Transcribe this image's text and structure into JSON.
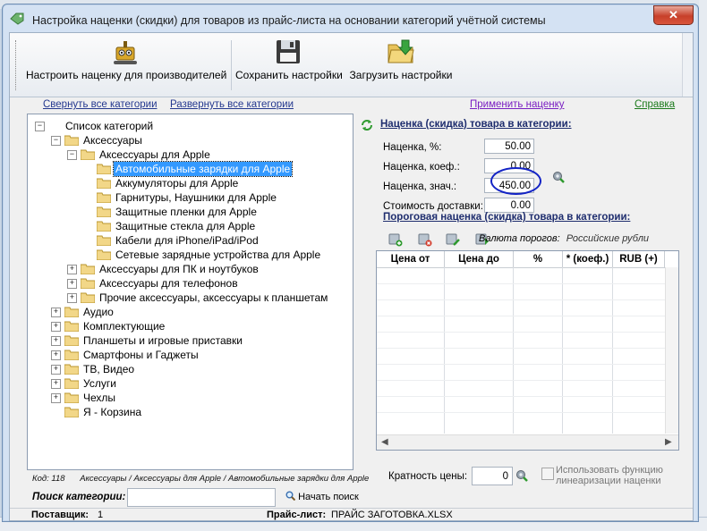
{
  "window": {
    "title": "Настройка наценки (скидки) для товаров из прайс-листа на основании категорий учётной системы",
    "close_label": "✕"
  },
  "toolbar": {
    "buttons": [
      {
        "label": "Настроить наценку для производителей",
        "icon": "robot-icon"
      },
      {
        "label": "Сохранить настройки",
        "icon": "floppy-disk-icon"
      },
      {
        "label": "Загрузить настройки",
        "icon": "folder-load-icon"
      }
    ]
  },
  "links": {
    "collapse_all": "Свернуть все категории",
    "expand_all": "Развернуть все категории",
    "apply": "Применить наценку",
    "help": "Справка"
  },
  "tree": {
    "root": "Список категорий",
    "items": [
      "Аксессуары",
      "Аксессуары для Apple",
      "Автомобильные зарядки для Apple",
      "Аккумуляторы для Apple",
      "Гарнитуры, Наушники для Apple",
      "Защитные пленки для Apple",
      "Защитные стекла для Apple",
      "Кабели для iPhone/iPad/iPod",
      "Сетевые зарядные устройства для Apple",
      "Аксессуары для ПК и ноутбуков",
      "Аксессуары для телефонов",
      "Прочие аксессуары, аксессуары к планшетам",
      "Аудио",
      "Комплектующие",
      "Планшеты и игровые приставки",
      "Смартфоны и Гаджеты",
      "ТВ, Видео",
      "Услуги",
      "Чехлы",
      "Я - Корзина"
    ],
    "selected": "Автомобильные зарядки для Apple"
  },
  "breadcrumb": {
    "code_label": "Код: 118",
    "path": "Аксессуары / Аксессуары для Apple / Автомобильные зарядки для Apple"
  },
  "search": {
    "label": "Поиск категории:",
    "value": "",
    "button": "Начать поиск"
  },
  "status": {
    "supplier_label": "Поставщик:",
    "supplier_value": "1",
    "pricelist_label": "Прайс-лист:",
    "pricelist_value": "ПРАЙС ЗАГОТОВКА.XLSX"
  },
  "markup": {
    "title": "Наценка (скидка) товара в категории:",
    "percent_label": "Наценка, %:",
    "percent_value": "50.00",
    "coef_label": "Наценка, коеф.:",
    "coef_value": "0.00",
    "value_label": "Наценка, знач.:",
    "value_value": "450.00",
    "delivery_label": "Стоимость доставки:",
    "delivery_value": "0.00"
  },
  "threshold": {
    "title": "Пороговая наценка (скидка) товара в категории:",
    "currency_label": "Валюта порогов:",
    "currency_value": "Российские рубли",
    "columns": [
      "Цена от",
      "Цена до",
      "%",
      "* (коеф.)",
      "RUB (+)"
    ]
  },
  "multiplicity": {
    "label": "Кратность цены:",
    "value": "0",
    "linearize_label": "Использовать функцию линеаризации наценки",
    "linearize_checked": false
  }
}
